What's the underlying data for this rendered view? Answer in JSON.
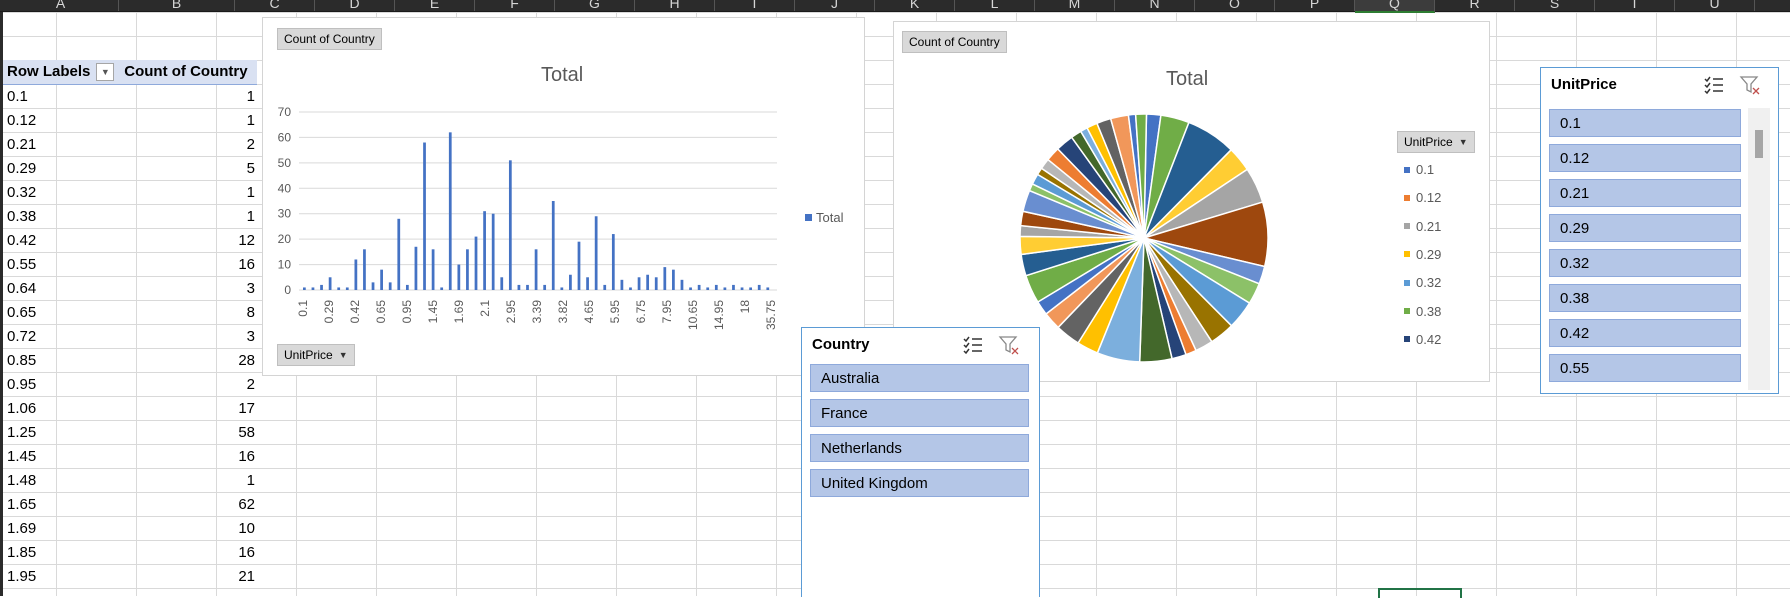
{
  "columns": [
    "A",
    "B",
    "C",
    "D",
    "E",
    "F",
    "G",
    "H",
    "I",
    "J",
    "K",
    "L",
    "M",
    "N",
    "O",
    "P",
    "Q",
    "R",
    "S",
    "T",
    "U"
  ],
  "selected_column": "Q",
  "pivot": {
    "header_row_labels": "Row Labels",
    "header_count": "Count of Country",
    "rows": [
      {
        "label": "0.1",
        "count": "1"
      },
      {
        "label": "0.12",
        "count": "1"
      },
      {
        "label": "0.21",
        "count": "2"
      },
      {
        "label": "0.29",
        "count": "5"
      },
      {
        "label": "0.32",
        "count": "1"
      },
      {
        "label": "0.38",
        "count": "1"
      },
      {
        "label": "0.42",
        "count": "12"
      },
      {
        "label": "0.55",
        "count": "16"
      },
      {
        "label": "0.64",
        "count": "3"
      },
      {
        "label": "0.65",
        "count": "8"
      },
      {
        "label": "0.72",
        "count": "3"
      },
      {
        "label": "0.85",
        "count": "28"
      },
      {
        "label": "0.95",
        "count": "2"
      },
      {
        "label": "1.06",
        "count": "17"
      },
      {
        "label": "1.25",
        "count": "58"
      },
      {
        "label": "1.45",
        "count": "16"
      },
      {
        "label": "1.48",
        "count": "1"
      },
      {
        "label": "1.65",
        "count": "62"
      },
      {
        "label": "1.69",
        "count": "10"
      },
      {
        "label": "1.85",
        "count": "16"
      },
      {
        "label": "1.95",
        "count": "21"
      }
    ]
  },
  "bar_chart": {
    "field_button": "Count of Country",
    "axis_button": "UnitPrice",
    "legend": "Total"
  },
  "pie_chart": {
    "field_button": "Count of Country",
    "legend_header": "UnitPrice",
    "legend_items": [
      {
        "label": "0.1",
        "color": "#4472c4"
      },
      {
        "label": "0.12",
        "color": "#ed7d31"
      },
      {
        "label": "0.21",
        "color": "#a5a5a5"
      },
      {
        "label": "0.29",
        "color": "#ffc000"
      },
      {
        "label": "0.32",
        "color": "#5b9bd5"
      },
      {
        "label": "0.38",
        "color": "#70ad47"
      },
      {
        "label": "0.42",
        "color": "#264478"
      }
    ],
    "slices": [
      4,
      8,
      14,
      7,
      10,
      18,
      5,
      6,
      8,
      7,
      5,
      3,
      4,
      9,
      12,
      6,
      7,
      5,
      4,
      8,
      6,
      5,
      3,
      4,
      6,
      2,
      3,
      2,
      3,
      4,
      5,
      3,
      2,
      3,
      4,
      5,
      2,
      3
    ]
  },
  "chart_data": [
    {
      "type": "bar",
      "title": "Total",
      "legend": "Total",
      "ylim": [
        0,
        70
      ],
      "yticks": [
        0,
        10,
        20,
        30,
        40,
        50,
        60,
        70
      ],
      "xticks": [
        "0.1",
        "0.29",
        "0.42",
        "0.65",
        "0.95",
        "1.45",
        "1.69",
        "2.1",
        "2.95",
        "3.39",
        "3.82",
        "4.65",
        "5.95",
        "6.75",
        "7.95",
        "10.65",
        "14.95",
        "18",
        "35.75"
      ],
      "values": [
        1,
        1,
        2,
        5,
        1,
        1,
        12,
        16,
        3,
        8,
        3,
        28,
        2,
        17,
        58,
        16,
        1,
        62,
        10,
        16,
        21,
        31,
        30,
        5,
        51,
        2,
        2,
        16,
        2,
        35,
        1,
        6,
        19,
        5,
        29,
        2,
        22,
        4,
        1,
        5,
        6,
        5,
        9,
        8,
        4,
        1,
        2,
        1,
        2,
        1,
        2,
        1,
        1,
        2,
        1
      ]
    },
    {
      "type": "pie",
      "title": "Total"
    }
  ],
  "country_slicer": {
    "title": "Country",
    "items": [
      "Australia",
      "France",
      "Netherlands",
      "United Kingdom"
    ]
  },
  "unitprice_slicer": {
    "title": "UnitPrice",
    "items": [
      "0.1",
      "0.12",
      "0.21",
      "0.29",
      "0.32",
      "0.38",
      "0.42",
      "0.55"
    ]
  }
}
